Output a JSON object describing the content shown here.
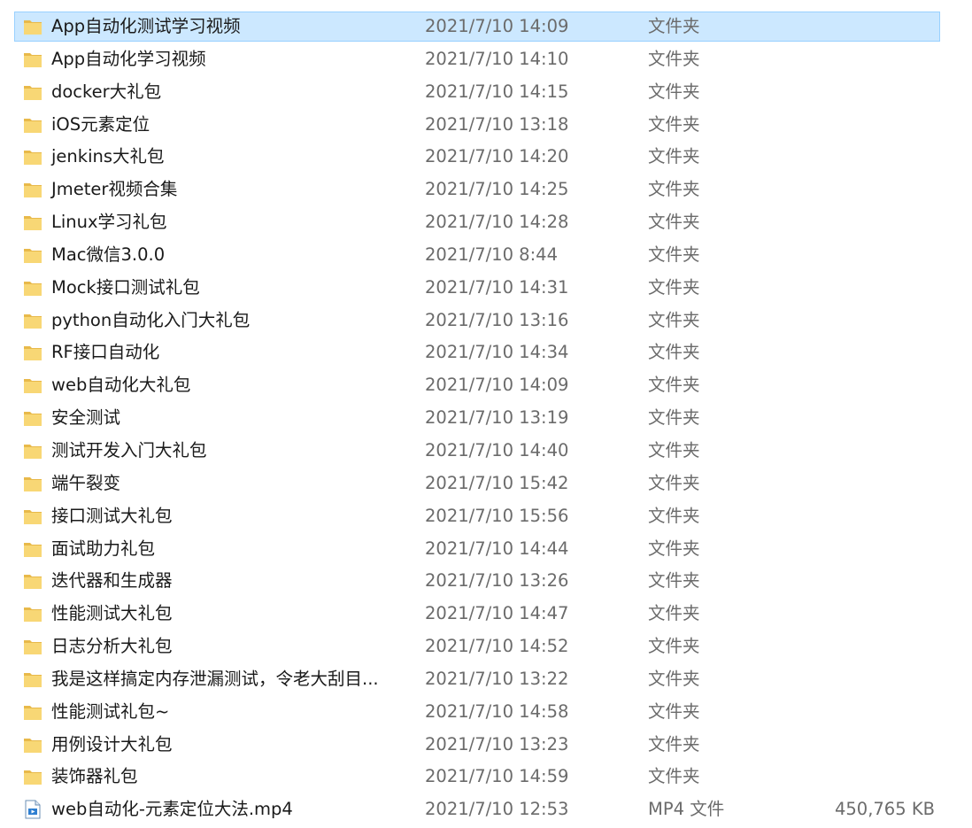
{
  "colors": {
    "selection_bg": "#cce8ff",
    "selection_border": "#99d1ff",
    "folder_yellow": "#f8d775",
    "folder_tab": "#e8b94a",
    "meta_text": "#6b6b6b"
  },
  "selected_index": 0,
  "files": [
    {
      "name": "App自动化测试学习视频",
      "modified": "2021/7/10 14:09",
      "type": "文件夹",
      "size": "",
      "icon": "folder-icon"
    },
    {
      "name": "App自动化学习视频",
      "modified": "2021/7/10 14:10",
      "type": "文件夹",
      "size": "",
      "icon": "folder-icon"
    },
    {
      "name": "docker大礼包",
      "modified": "2021/7/10 14:15",
      "type": "文件夹",
      "size": "",
      "icon": "folder-icon"
    },
    {
      "name": "iOS元素定位",
      "modified": "2021/7/10 13:18",
      "type": "文件夹",
      "size": "",
      "icon": "folder-icon"
    },
    {
      "name": "jenkins大礼包",
      "modified": "2021/7/10 14:20",
      "type": "文件夹",
      "size": "",
      "icon": "folder-icon"
    },
    {
      "name": "Jmeter视频合集",
      "modified": "2021/7/10 14:25",
      "type": "文件夹",
      "size": "",
      "icon": "folder-icon"
    },
    {
      "name": "Linux学习礼包",
      "modified": "2021/7/10 14:28",
      "type": "文件夹",
      "size": "",
      "icon": "folder-icon"
    },
    {
      "name": "Mac微信3.0.0",
      "modified": "2021/7/10 8:44",
      "type": "文件夹",
      "size": "",
      "icon": "folder-icon"
    },
    {
      "name": "Mock接口测试礼包",
      "modified": "2021/7/10 14:31",
      "type": "文件夹",
      "size": "",
      "icon": "folder-icon"
    },
    {
      "name": "python自动化入门大礼包",
      "modified": "2021/7/10 13:16",
      "type": "文件夹",
      "size": "",
      "icon": "folder-icon"
    },
    {
      "name": "RF接口自动化",
      "modified": "2021/7/10 14:34",
      "type": "文件夹",
      "size": "",
      "icon": "folder-icon"
    },
    {
      "name": "web自动化大礼包",
      "modified": "2021/7/10 14:09",
      "type": "文件夹",
      "size": "",
      "icon": "folder-icon"
    },
    {
      "name": "安全测试",
      "modified": "2021/7/10 13:19",
      "type": "文件夹",
      "size": "",
      "icon": "folder-icon"
    },
    {
      "name": "测试开发入门大礼包",
      "modified": "2021/7/10 14:40",
      "type": "文件夹",
      "size": "",
      "icon": "folder-icon"
    },
    {
      "name": "端午裂变",
      "modified": "2021/7/10 15:42",
      "type": "文件夹",
      "size": "",
      "icon": "folder-icon"
    },
    {
      "name": "接口测试大礼包",
      "modified": "2021/7/10 15:56",
      "type": "文件夹",
      "size": "",
      "icon": "folder-icon"
    },
    {
      "name": "面试助力礼包",
      "modified": "2021/7/10 14:44",
      "type": "文件夹",
      "size": "",
      "icon": "folder-icon"
    },
    {
      "name": "迭代器和生成器",
      "modified": "2021/7/10 13:26",
      "type": "文件夹",
      "size": "",
      "icon": "folder-icon"
    },
    {
      "name": "性能测试大礼包",
      "modified": "2021/7/10 14:47",
      "type": "文件夹",
      "size": "",
      "icon": "folder-icon"
    },
    {
      "name": "日志分析大礼包",
      "modified": "2021/7/10 14:52",
      "type": "文件夹",
      "size": "",
      "icon": "folder-icon"
    },
    {
      "name": "我是这样搞定内存泄漏测试，令老大刮目...",
      "modified": "2021/7/10 13:22",
      "type": "文件夹",
      "size": "",
      "icon": "folder-icon"
    },
    {
      "name": "性能测试礼包~",
      "modified": "2021/7/10 14:58",
      "type": "文件夹",
      "size": "",
      "icon": "folder-icon"
    },
    {
      "name": "用例设计大礼包",
      "modified": "2021/7/10 13:23",
      "type": "文件夹",
      "size": "",
      "icon": "folder-icon"
    },
    {
      "name": "装饰器礼包",
      "modified": "2021/7/10 14:59",
      "type": "文件夹",
      "size": "",
      "icon": "folder-icon"
    },
    {
      "name": "web自动化-元素定位大法.mp4",
      "modified": "2021/7/10 12:53",
      "type": "MP4 文件",
      "size": "450,765 KB",
      "icon": "video-file-icon"
    }
  ]
}
